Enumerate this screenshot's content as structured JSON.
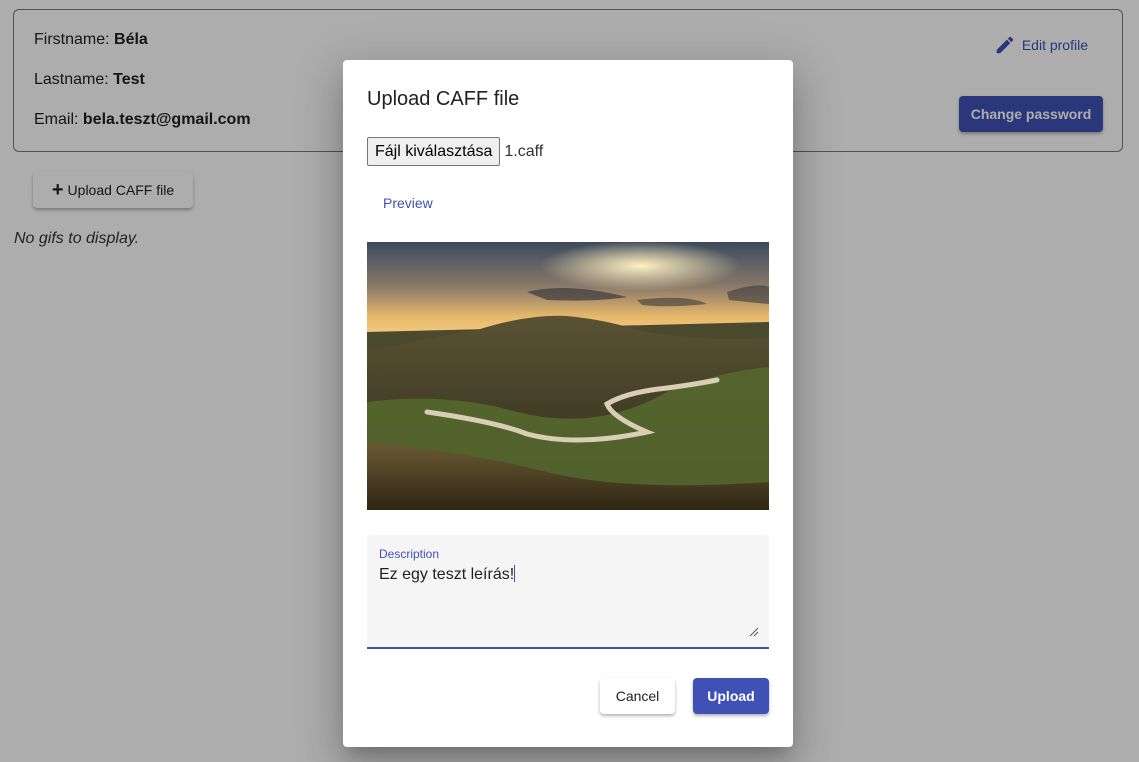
{
  "profile": {
    "firstname_label": "Firstname:",
    "firstname_value": "Béla",
    "lastname_label": "Lastname:",
    "lastname_value": "Test",
    "email_label": "Email:",
    "email_value": "bela.teszt@gmail.com",
    "edit_profile_label": "Edit profile",
    "change_password_label": "Change password"
  },
  "main": {
    "upload_button_label": "Upload CAFF file",
    "empty_message": "No gifs to display."
  },
  "dialog": {
    "title": "Upload CAFF file",
    "file_button_label": "Fájl kiválasztása",
    "file_name": "1.caff",
    "preview_label": "Preview",
    "description_label": "Description",
    "description_value": "Ez egy teszt leírás!",
    "cancel_label": "Cancel",
    "upload_label": "Upload"
  },
  "colors": {
    "primary": "#3f51b5",
    "backdrop": "rgba(0,0,0,0.32)"
  },
  "icons": {
    "edit": "pencil-icon",
    "add": "plus-icon"
  }
}
